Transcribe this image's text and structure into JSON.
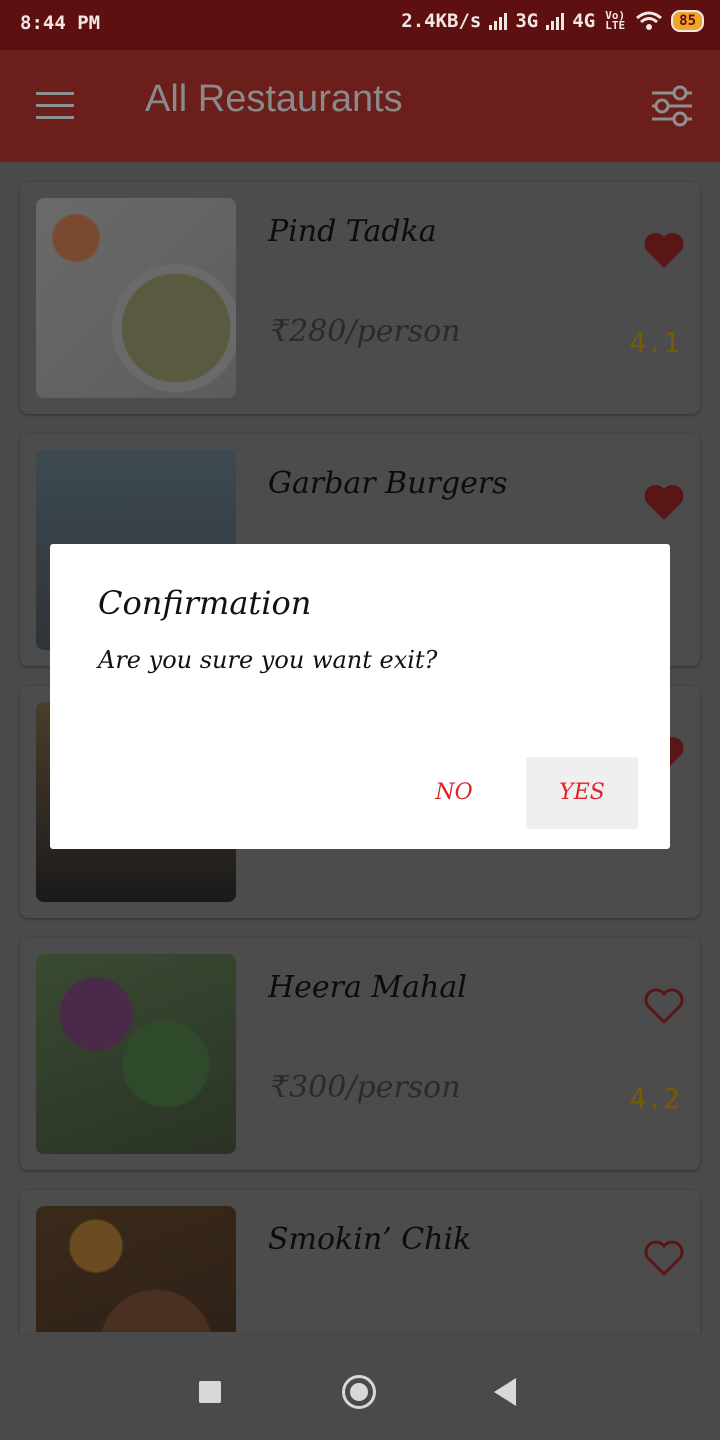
{
  "status_bar": {
    "time": "8:44 PM",
    "network_speed": "2.4KB/s",
    "network_3g": "3G",
    "network_4g": "4G",
    "volte": "Vo) LTE",
    "battery": "85"
  },
  "app_bar": {
    "title": "All Restaurants",
    "menu_icon": "hamburger-menu-icon",
    "filter_icon": "sliders-filter-icon"
  },
  "restaurants": [
    {
      "name": "Pind Tadka",
      "price": "₹280/person",
      "rating": "4.1",
      "favorite": true
    },
    {
      "name": "Garbar Burgers",
      "price": "",
      "rating": "",
      "favorite": true
    },
    {
      "name": "",
      "price": "",
      "rating": "",
      "favorite": true
    },
    {
      "name": "Heera Mahal",
      "price": "₹300/person",
      "rating": "4.2",
      "favorite": false
    },
    {
      "name": "Smokin’ Chik",
      "price": "",
      "rating": "",
      "favorite": false
    }
  ],
  "dialog": {
    "title": "Confirmation",
    "message": "Are you sure you want exit?",
    "no_label": "NO",
    "yes_label": "YES"
  },
  "colors": {
    "accent": "#e0232b",
    "app_bar": "#c0392b",
    "heart": "#b0282b",
    "rating": "#d9a400"
  }
}
